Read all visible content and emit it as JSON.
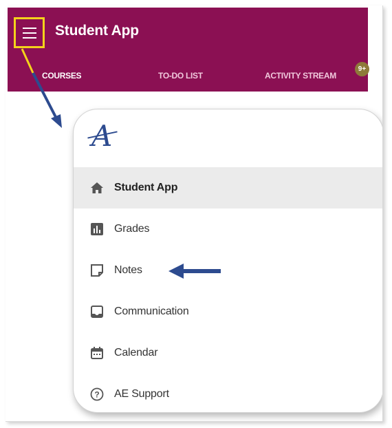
{
  "app": {
    "title": "Student App",
    "menu_icon": "hamburger-menu-icon",
    "brand_color": "#8b1053",
    "highlight_color": "#f4d21b",
    "annotation_color": "#2d4b8f"
  },
  "tabs": [
    {
      "label": "COURSES",
      "active": true
    },
    {
      "label": "TO-DO LIST",
      "active": false
    },
    {
      "label": "ACTIVITY STREAM",
      "active": false,
      "badge": "9+"
    }
  ],
  "drawer": {
    "logo": "A",
    "items": [
      {
        "label": "Student App",
        "icon": "home-icon",
        "active": true
      },
      {
        "label": "Grades",
        "icon": "grades-icon",
        "active": false
      },
      {
        "label": "Notes",
        "icon": "notes-icon",
        "active": false
      },
      {
        "label": "Communication",
        "icon": "communication-icon",
        "active": false
      },
      {
        "label": "Calendar",
        "icon": "calendar-icon",
        "active": false
      },
      {
        "label": "AE Support",
        "icon": "help-icon",
        "active": false
      }
    ]
  }
}
